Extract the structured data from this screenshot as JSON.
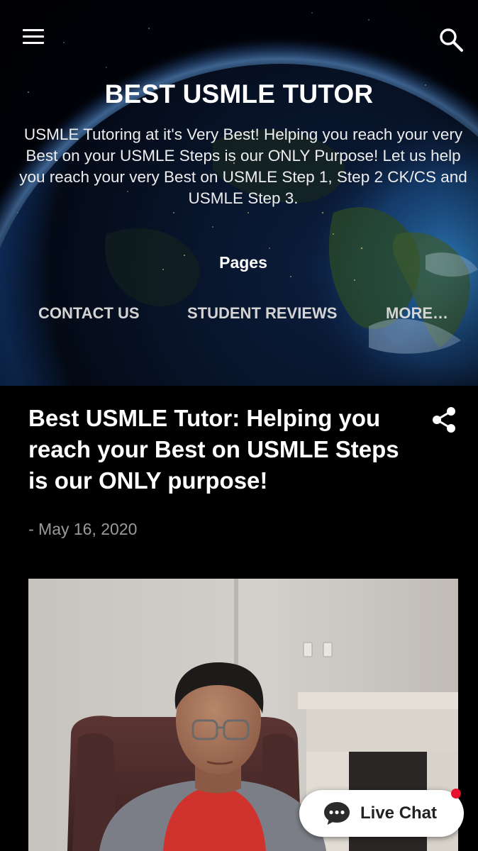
{
  "header": {
    "menu_icon": "hamburger-menu-icon",
    "search_icon": "search-icon",
    "title": "BEST USMLE TUTOR",
    "description": "USMLE Tutoring at it's Very Best! Helping you reach your very Best on your USMLE Steps is our ONLY Purpose! Let us help you reach your very Best on USMLE Step 1, Step 2 CK/CS and USMLE Step 3."
  },
  "pages": {
    "heading": "Pages",
    "items": [
      {
        "label": "CONTACT US"
      },
      {
        "label": "STUDENT REVIEWS"
      },
      {
        "label": "MORE…"
      }
    ]
  },
  "post": {
    "title": "Best USMLE Tutor: Helping you reach your Best on USMLE Steps is our ONLY purpose!",
    "date": "- May 16, 2020",
    "share_icon": "share-icon",
    "image": "tutor-photo"
  },
  "live_chat": {
    "label": "Live Chat",
    "icon": "chat-bubble-icon",
    "badge_color": "#e8112d"
  },
  "colors": {
    "background": "#000000",
    "text": "#ffffff",
    "nav_text": "#d4d4d4",
    "date_text": "#9a9a9a"
  }
}
